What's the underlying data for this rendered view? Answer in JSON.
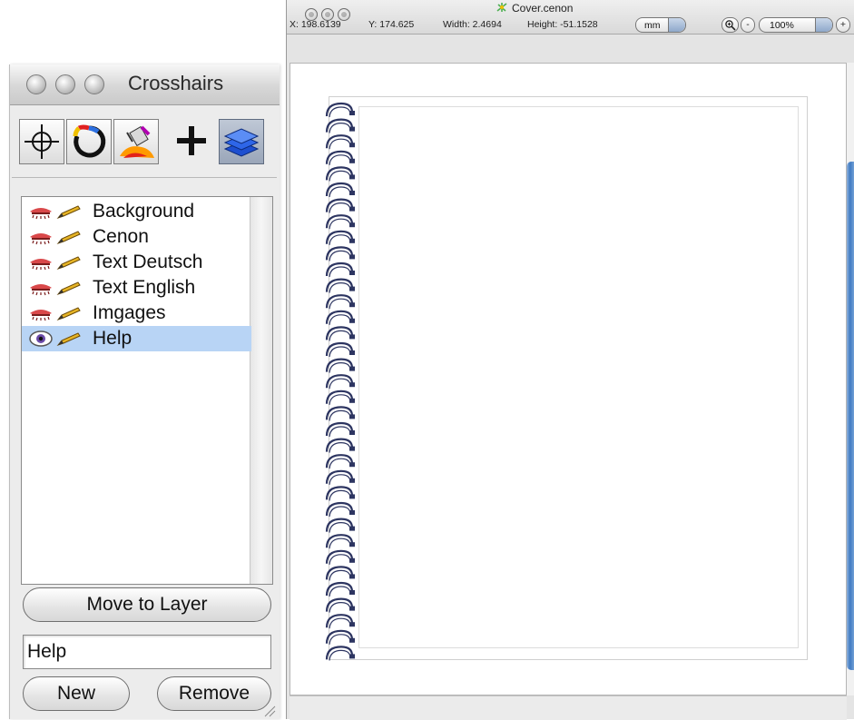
{
  "panel": {
    "title": "Crosshairs",
    "tools": [
      {
        "name": "crosshair-tool",
        "icon": "crosshair-icon",
        "selected": false
      },
      {
        "name": "rotate-tool",
        "icon": "rotate-icon",
        "selected": false
      },
      {
        "name": "paint-bucket-tool",
        "icon": "paint-bucket-icon",
        "selected": false
      },
      {
        "name": "add-point-tool",
        "icon": "plus-icon",
        "selected": false
      },
      {
        "name": "layers-tool",
        "icon": "layers-icon",
        "selected": true
      }
    ],
    "layers": [
      {
        "label": "Background",
        "visible": false,
        "editable": true
      },
      {
        "label": "Cenon",
        "visible": false,
        "editable": true
      },
      {
        "label": "Text Deutsch",
        "visible": false,
        "editable": true
      },
      {
        "label": "Text English",
        "visible": false,
        "editable": true
      },
      {
        "label": "Imgages",
        "visible": false,
        "editable": true
      },
      {
        "label": "Help",
        "visible": true,
        "editable": true,
        "selected": true
      }
    ],
    "move_to_layer_label": "Move to Layer",
    "name_field_value": "Help",
    "new_label": "New",
    "remove_label": "Remove"
  },
  "doc": {
    "title": "Cover.cenon",
    "x_readout": "X: 198.6139",
    "y_readout": "Y: 174.625",
    "width_readout": "Width: 2.4694",
    "height_readout": "Height: -51.1528",
    "unit": "mm",
    "zoom_in_label": "-",
    "zoom_value": "100%",
    "zoom_out_label": "+"
  },
  "colors": {
    "selection": "#b8d4f5",
    "binding_ring": "#2d3561",
    "scroll_accent": "#3f7ac2"
  }
}
